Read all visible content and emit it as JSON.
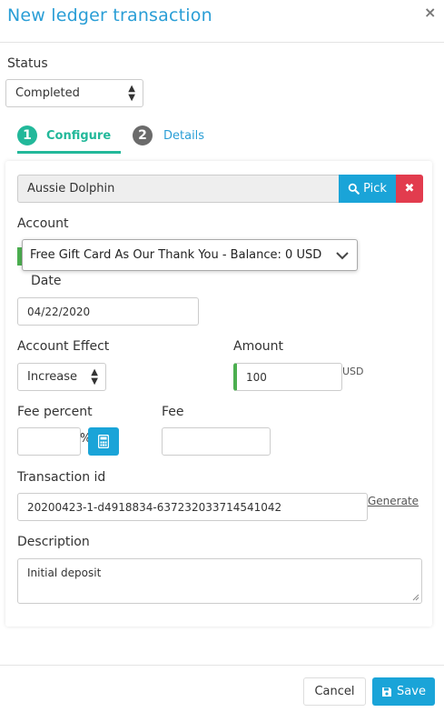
{
  "dialog": {
    "title": "New ledger transaction",
    "close_glyph": "×"
  },
  "status": {
    "label": "Status",
    "value": "Completed"
  },
  "tabs": [
    {
      "num": "1",
      "label": "Configure",
      "active": true
    },
    {
      "num": "2",
      "label": "Details",
      "active": false
    }
  ],
  "user": {
    "value": "Aussie Dolphin",
    "pick_label": "Pick",
    "clear_glyph": "✖"
  },
  "account": {
    "label": "Account",
    "value": "Free Gift Card As Our Thank You - Balance: 0 USD"
  },
  "date": {
    "label": "Date",
    "value": "04/22/2020"
  },
  "account_effect": {
    "label": "Account Effect",
    "value": "Increase"
  },
  "amount": {
    "label": "Amount",
    "value": "100",
    "currency": "USD"
  },
  "fee_percent": {
    "label": "Fee percent",
    "value": "",
    "unit": "%"
  },
  "fee": {
    "label": "Fee",
    "value": ""
  },
  "transaction_id": {
    "label": "Transaction id",
    "value": "20200423-1-d4918834-637232033714541042",
    "generate_label": "Generate"
  },
  "description": {
    "label": "Description",
    "value": "Initial deposit"
  },
  "footer": {
    "cancel_label": "Cancel",
    "save_label": "Save"
  },
  "colors": {
    "accent": "#1aa4d8",
    "title": "#2a9ed6",
    "active_tab": "#22b89a",
    "danger": "#e23c4e",
    "valid": "#4caf50",
    "inactive_step": "#6b6b6b"
  }
}
